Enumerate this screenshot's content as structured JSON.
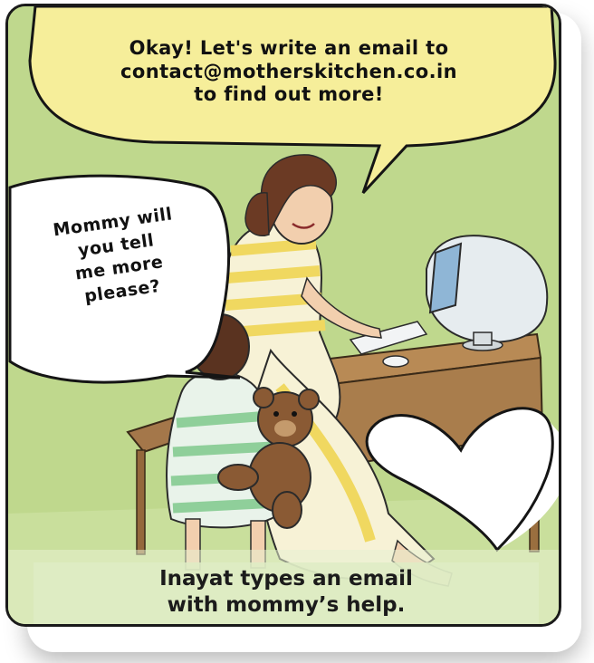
{
  "top_speech": {
    "lines": [
      "Okay! Let's write an email to",
      "contact@motherskitchen.co.in",
      "to find out more!"
    ]
  },
  "child_speech": {
    "lines": [
      "Mommy will",
      "you tell",
      "me more",
      "please?"
    ]
  },
  "caption": {
    "lines": [
      "Inayat types an email",
      "with mommy’s help."
    ]
  },
  "colors": {
    "background_green": "#bfd88d",
    "speech_yellow": "#f6ee9a",
    "speech_white": "#ffffff",
    "caption_band": "#e1edc8"
  },
  "icons": [
    "heart-outline-icon"
  ]
}
